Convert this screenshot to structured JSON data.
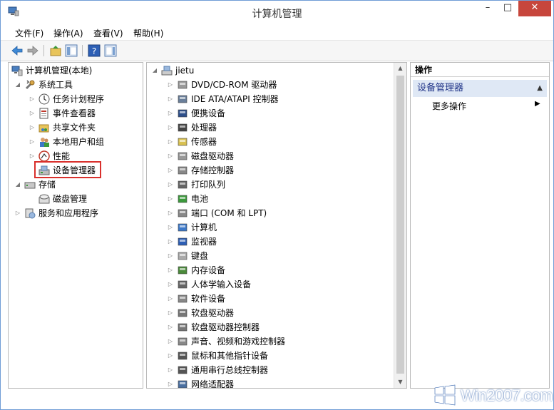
{
  "window": {
    "title": "计算机管理"
  },
  "menubar": {
    "items": [
      "文件(F)",
      "操作(A)",
      "查看(V)",
      "帮助(H)"
    ]
  },
  "left_tree": {
    "items": [
      {
        "label": "计算机管理(本地)"
      },
      {
        "label": "系统工具"
      },
      {
        "label": "任务计划程序"
      },
      {
        "label": "事件查看器"
      },
      {
        "label": "共享文件夹"
      },
      {
        "label": "本地用户和组"
      },
      {
        "label": "性能"
      },
      {
        "label": "设备管理器"
      },
      {
        "label": "存储"
      },
      {
        "label": "磁盘管理"
      },
      {
        "label": "服务和应用程序"
      }
    ]
  },
  "device_tree": {
    "root": "jietu",
    "items": [
      "DVD/CD-ROM 驱动器",
      "IDE ATA/ATAPI 控制器",
      "便携设备",
      "处理器",
      "传感器",
      "磁盘驱动器",
      "存储控制器",
      "打印队列",
      "电池",
      "端口 (COM 和 LPT)",
      "计算机",
      "监视器",
      "键盘",
      "内存设备",
      "人体学输入设备",
      "软件设备",
      "软盘驱动器",
      "软盘驱动器控制器",
      "声音、视频和游戏控制器",
      "鼠标和其他指针设备",
      "通用串行总线控制器",
      "网络适配器"
    ]
  },
  "actions": {
    "header": "操作",
    "section": "设备管理器",
    "more": "更多操作"
  },
  "watermark": {
    "text": "Win2007.com"
  },
  "colors": {
    "selection_border": "#d9302c",
    "accent": "#1e3287",
    "close": "#c7463c"
  }
}
